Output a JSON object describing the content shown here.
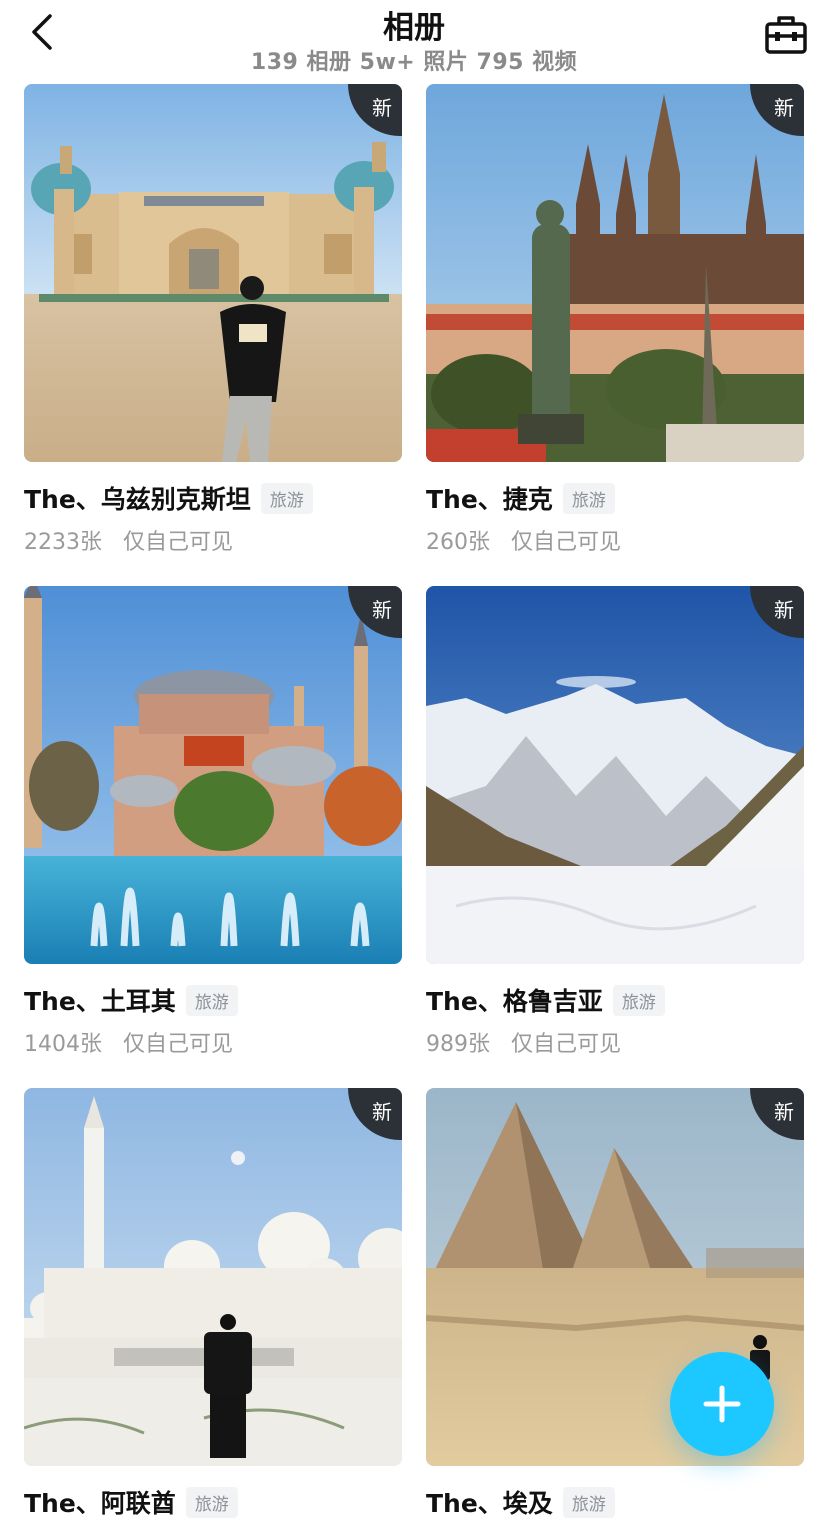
{
  "header": {
    "title": "相册",
    "subtitle": "139 相册 5w+ 照片 795 视频"
  },
  "icons": {
    "back": "chevron-left-icon",
    "toolbox": "toolbox-icon",
    "add": "plus-icon"
  },
  "albums": [
    {
      "name": "The、乌兹别克斯坦",
      "tag": "旅游",
      "count": "2233张",
      "visibility": "仅自己可见",
      "badge": "新"
    },
    {
      "name": "The、捷克",
      "tag": "旅游",
      "count": "260张",
      "visibility": "仅自己可见",
      "badge": "新"
    },
    {
      "name": "The、土耳其",
      "tag": "旅游",
      "count": "1404张",
      "visibility": "仅自己可见",
      "badge": "新"
    },
    {
      "name": "The、格鲁吉亚",
      "tag": "旅游",
      "count": "989张",
      "visibility": "仅自己可见",
      "badge": "新"
    },
    {
      "name": "The、阿联酋",
      "tag": "旅游",
      "badge": "新"
    },
    {
      "name": "The、埃及",
      "tag": "旅游",
      "badge": "新"
    }
  ],
  "colors": {
    "fab": "#1cc8ff",
    "badge_bg": "#2c3138",
    "tag_bg": "#f2f3f5",
    "muted_text": "#9a9a9a"
  }
}
